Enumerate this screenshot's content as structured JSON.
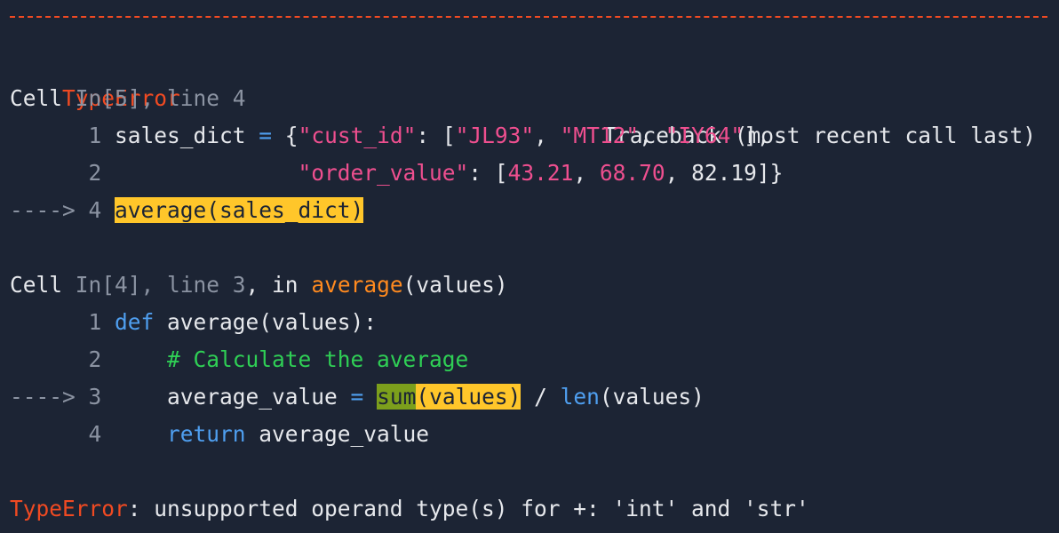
{
  "header": {
    "error_type": "TypeError",
    "traceback_label": "Traceback (most recent call last)"
  },
  "frame1": {
    "cell_label": "Cell",
    "cell_ref": "In[5], line 4",
    "lines": [
      {
        "gutter": "      1 ",
        "p1": "sales_dict ",
        "p2": "=",
        "p3": " {",
        "s1": "\"cust_id\"",
        "p4": ": [",
        "s2": "\"JL93\"",
        "p5": ", ",
        "s3": "\"MT12\"",
        "p6": ", ",
        "s4": "\"IY64\"",
        "p7": "],"
      },
      {
        "gutter": "      2 ",
        "indent": "              ",
        "s1": "\"order_value\"",
        "p1": ": [",
        "n1": "43.21",
        "p2": ", ",
        "n2": "68.70",
        "p3": ", ",
        "n3": "82.19",
        "p4": "]}"
      },
      {
        "gutter": "----> 4 ",
        "code": "average(sales_dict)"
      }
    ]
  },
  "frame2": {
    "cell_label": "Cell",
    "cell_ref": "In[4], line 3",
    "in_word": ", in ",
    "func": "average",
    "args": "(values)",
    "lines": [
      {
        "gutter": "      1 ",
        "kw": "def",
        "rest": " average(values):"
      },
      {
        "gutter": "      2 ",
        "indent": "    ",
        "comment": "# Calculate the average"
      },
      {
        "gutter": "----> 3 ",
        "indent": "    ",
        "p1": "average_value ",
        "op": "=",
        "sp": " ",
        "h1": "sum",
        "h2": "(values)",
        "p2": " / ",
        "kw": "len",
        "p3": "(values)"
      },
      {
        "gutter": "      4 ",
        "indent": "    ",
        "kw": "return",
        "rest": " average_value"
      }
    ]
  },
  "footer": {
    "error_type": "TypeError",
    "message": ": unsupported operand type(s) for +: 'int' and 'str'"
  }
}
